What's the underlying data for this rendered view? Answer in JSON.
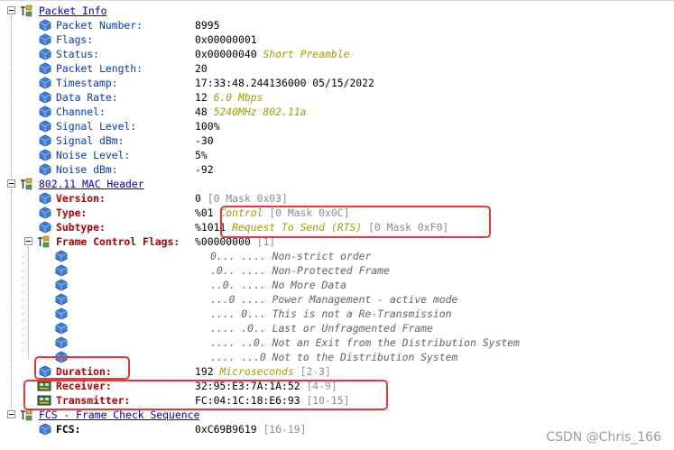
{
  "packet_info": {
    "title": "Packet Info",
    "fields": [
      {
        "label": "Packet Number:",
        "value": "8995",
        "note": ""
      },
      {
        "label": "Flags:",
        "value": "0x00000001",
        "note": ""
      },
      {
        "label": "Status:",
        "value": "0x00000040",
        "note": "Short Preamble"
      },
      {
        "label": "Packet Length:",
        "value": "20",
        "note": ""
      },
      {
        "label": "Timestamp:",
        "value": "17:33:48.244136000 05/15/2022",
        "note": ""
      },
      {
        "label": "Data Rate:",
        "value": "12",
        "note": "6.0 Mbps"
      },
      {
        "label": "Channel:",
        "value": "48",
        "note": "5240MHz  802.11a"
      },
      {
        "label": "Signal Level:",
        "value": "100%",
        "note": ""
      },
      {
        "label": "Signal dBm:",
        "value": "-30",
        "note": ""
      },
      {
        "label": "Noise Level:",
        "value": "5%",
        "note": ""
      },
      {
        "label": "Noise dBm:",
        "value": "-92",
        "note": ""
      }
    ]
  },
  "mac_header": {
    "title": "802.11 MAC Header",
    "version": {
      "label": "Version:",
      "value": "0",
      "mask": "[0 Mask 0x03]"
    },
    "type": {
      "label": "Type:",
      "value": "%01",
      "note": "Control",
      "mask": "[0 Mask 0x0C]"
    },
    "subtype": {
      "label": "Subtype:",
      "value": "%1011",
      "note": "Request To Send (RTS)",
      "mask": "[0 Mask 0xF0]"
    },
    "frame_control": {
      "label": "Frame Control Flags:",
      "value": "%00000000",
      "mask": "[1]",
      "bits": [
        {
          "pattern": "0... ....",
          "text": "Non-strict order"
        },
        {
          "pattern": ".0.. ....",
          "text": "Non-Protected Frame"
        },
        {
          "pattern": "..0. ....",
          "text": "No More Data"
        },
        {
          "pattern": "...0 ....",
          "text": "Power Management - active mode"
        },
        {
          "pattern": ".... 0...",
          "text": "This is not a Re-Transmission"
        },
        {
          "pattern": ".... .0..",
          "text": "Last or Unfragmented Frame"
        },
        {
          "pattern": ".... ..0.",
          "text": "Not an Exit from the Distribution System"
        },
        {
          "pattern": ".... ...0",
          "text": "Not to the Distribution System"
        }
      ]
    },
    "duration": {
      "label": "Duration:",
      "value": "192",
      "note": "Microseconds",
      "mask": "[2-3]"
    },
    "receiver": {
      "label": "Receiver:",
      "value": "32:95:E3:7A:1A:52",
      "mask": "[4-9]"
    },
    "transmitter": {
      "label": "Transmitter:",
      "value": "FC:04:1C:18:E6:93",
      "mask": "[10-15]"
    }
  },
  "fcs": {
    "title": "FCS - Frame Check Sequence",
    "field": {
      "label": "FCS:",
      "value": "0xC69B9619",
      "mask": "[16-19]"
    }
  },
  "watermark": "CSDN @Chris_166",
  "colors": {
    "highlight_box": "#e43a3a",
    "section_link": "#0000c8",
    "field_red": "#b40000",
    "annotation": "#a0a000"
  }
}
